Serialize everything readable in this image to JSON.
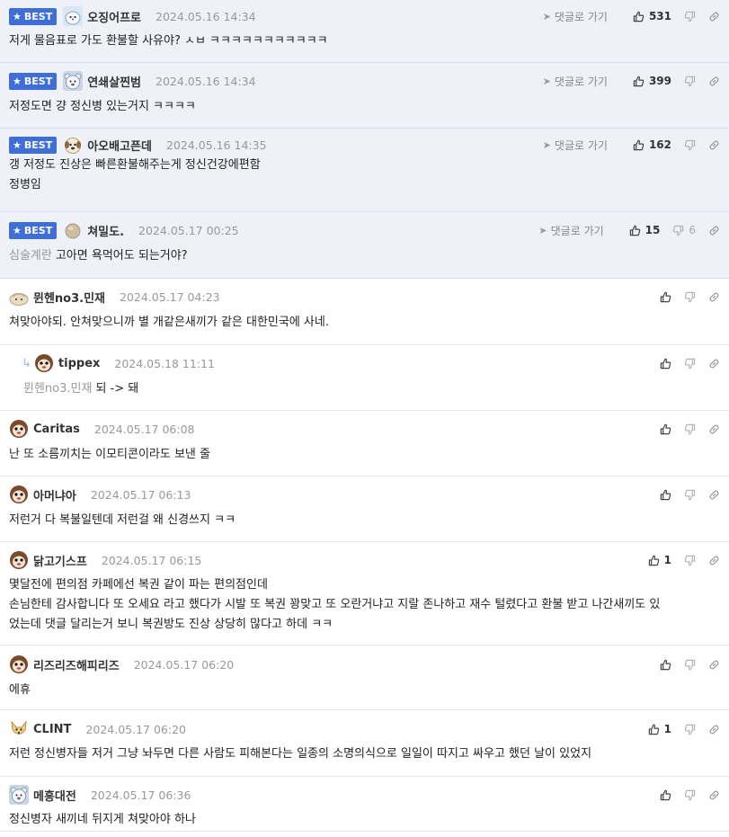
{
  "ui": {
    "best_label": "BEST",
    "goto_label": "댓글로 가기"
  },
  "comments": [
    {
      "best": true,
      "avatar": "seal-avatar",
      "nick": "오징어프로",
      "date": "2024.05.16 14:34",
      "likes": "531",
      "dislikes": "",
      "mention": "",
      "lines": [
        "저게 물음표로 가도 환불할 사유야? ㅅㅂ ㅋㅋㅋㅋㅋㅋㅋㅋㅋㅋㅋ"
      ]
    },
    {
      "best": true,
      "avatar": "bear-avatar",
      "nick": "연쇄살찐범",
      "date": "2024.05.16 14:34",
      "likes": "399",
      "dislikes": "",
      "mention": "",
      "lines": [
        "저정도면 걍 정신병 있는거지 ㅋㅋㅋㅋ"
      ]
    },
    {
      "best": true,
      "avatar": "dog-avatar",
      "nick": "아오배고픈데",
      "date": "2024.05.16 14:35",
      "likes": "162",
      "dislikes": "",
      "mention": "",
      "lines": [
        "갱 저정도 진상은 빠른환불해주는게 정신건강에편함",
        "정병임"
      ]
    },
    {
      "best": true,
      "avatar": "orb-avatar",
      "nick": "쳐밀도.",
      "date": "2024.05.17 00:25",
      "likes": "15",
      "dislikes": "6",
      "mention": "심술계란",
      "lines": [
        "고아면 욕먹어도 되는거야?"
      ]
    },
    {
      "best": false,
      "avatar": "dumpling-avatar",
      "nick": "뮌헨no3.민재",
      "date": "2024.05.17 04:23",
      "likes": "",
      "dislikes": "",
      "mention": "",
      "lines": [
        "쳐맞아야되. 안쳐맞으니까 별 개같은새끼가 같은 대한민국에 사네."
      ]
    },
    {
      "best": false,
      "reply": true,
      "avatar": "monkey-avatar",
      "nick": "tippex",
      "date": "2024.05.18 11:11",
      "likes": "",
      "dislikes": "",
      "mention": "뮌헨no3.민재",
      "lines": [
        "되 -> 돼"
      ]
    },
    {
      "best": false,
      "avatar": "monkey-avatar",
      "nick": "Caritas",
      "date": "2024.05.17 06:08",
      "likes": "",
      "dislikes": "",
      "mention": "",
      "lines": [
        "난 또 소름끼치는 이모티콘이라도 보낸 줄"
      ]
    },
    {
      "best": false,
      "avatar": "monkey-avatar",
      "nick": "아머냐아",
      "date": "2024.05.17 06:13",
      "likes": "",
      "dislikes": "",
      "mention": "",
      "lines": [
        "저런거 다 복불일텐데 저런걸 왜 신경쓰지 ㅋㅋ"
      ]
    },
    {
      "best": false,
      "avatar": "monkey-avatar",
      "nick": "닭고기스프",
      "date": "2024.05.17 06:15",
      "likes": "1",
      "dislikes": "",
      "mention": "",
      "lines": [
        "몇달전에 편의점 카페에선 복권 같이 파는 편의점인데",
        "손님한테 감사합니다 또 오세요 라고 했다가 시발 또 복권 꽝맞고 또 오란거냐고 지랄 존나하고 재수 털렸다고 환불 받고 나간새끼도 있",
        "었는데 댓글 달리는거 보니 복권방도 진상 상당히 많다고 하데 ㅋㅋ"
      ]
    },
    {
      "best": false,
      "avatar": "monkey-avatar",
      "nick": "리즈리즈해피리즈",
      "date": "2024.05.17 06:20",
      "likes": "",
      "dislikes": "",
      "mention": "",
      "lines": [
        "에휴"
      ]
    },
    {
      "best": false,
      "avatar": "fox-avatar",
      "nick": "CLINT",
      "date": "2024.05.17 06:20",
      "likes": "1",
      "dislikes": "",
      "mention": "",
      "lines": [
        "저런 정신병자들 저거 그냥 놔두면 다른 사람도 피해본다는 일종의 소명의식으로 일일이 따지고 싸우고 했던 날이 있었지"
      ]
    },
    {
      "best": false,
      "avatar": "bear-avatar",
      "nick": "메흥대전",
      "date": "2024.05.17 06:36",
      "likes": "",
      "dislikes": "",
      "mention": "",
      "lines": [
        "정신병자 새끼네 뒤지게 쳐맞아야 하나"
      ]
    }
  ]
}
